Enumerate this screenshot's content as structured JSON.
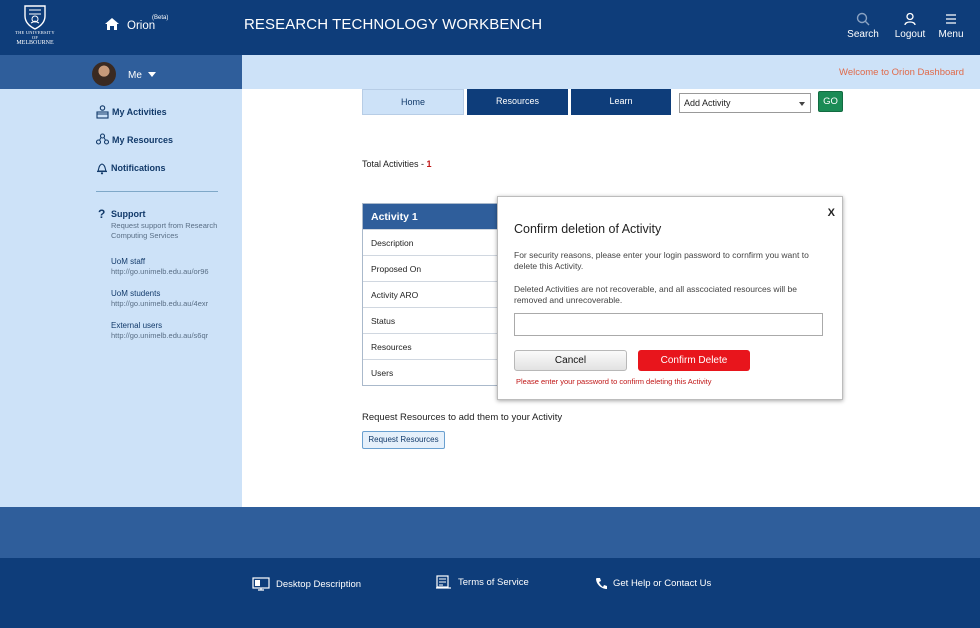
{
  "header": {
    "logo_line1": "THE UNIVERSITY OF",
    "logo_line2": "MELBOURNE",
    "app_name": "Orion",
    "app_badge": "(Beta)",
    "title": "RESEARCH TECHNOLOGY WORKBENCH",
    "tools": [
      {
        "label": "Search",
        "icon": "search-icon"
      },
      {
        "label": "Logout",
        "icon": "user-icon"
      },
      {
        "label": "Menu",
        "icon": "menu-icon"
      }
    ]
  },
  "user": {
    "name": "Me"
  },
  "welcome": "Welcome to Orion Dashboard",
  "sidebar": {
    "items": [
      {
        "label": "My  Activities",
        "icon": "activities-icon"
      },
      {
        "label": "My Resources",
        "icon": "resources-icon"
      },
      {
        "label": "Notifications",
        "icon": "bell-icon"
      }
    ],
    "support": {
      "title": "Support",
      "desc": "Request support from Research Computing Services",
      "links": [
        {
          "title": "UoM staff",
          "url": "http://go.unimelb.edu.au/or96"
        },
        {
          "title": "UoM students",
          "url": "http://go.unimelb.edu.au/4exr"
        },
        {
          "title": "External users",
          "url": "http://go.unimelb.edu.au/s6qr"
        }
      ]
    }
  },
  "tabs": [
    {
      "label": "Home",
      "active": true
    },
    {
      "label": "Resources",
      "active": false
    },
    {
      "label": "Learn",
      "active": false
    }
  ],
  "add_select": {
    "value": "Add Activity"
  },
  "go_label": "GO",
  "total": {
    "label": "Total Activities  - ",
    "count": "1"
  },
  "activity_card": {
    "title": "Activity 1",
    "rows": [
      "Description",
      "Proposed On",
      "Activity ARO",
      "Status",
      "Resources",
      "Users"
    ]
  },
  "request": {
    "text": "Request Resources to add them to your  Activity",
    "button": "Request Resources"
  },
  "modal": {
    "close": "X",
    "title": "Confirm deletion of Activity",
    "p1": "For security reasons, please enter your login password to cornfirm you want to delete this Activity.",
    "p2": "Deleted Activities are not recoverable, and all asscociated resources will be removed and unrecoverable.",
    "password_value": "",
    "cancel": "Cancel",
    "confirm": "Confirm Delete",
    "error": "Please enter your password to confirm deleting this Activity"
  },
  "footer": {
    "links": [
      {
        "label": "Desktop Description",
        "icon": "monitor-icon"
      },
      {
        "label": "Terms of Service",
        "icon": "terms-icon"
      },
      {
        "label": "Get Help or Contact Us",
        "icon": "phone-icon"
      }
    ]
  },
  "colors": {
    "navy": "#0e3d7a",
    "mid_blue": "#2f5e9b",
    "light_blue": "#cde2f8",
    "go_green": "#1a8b55",
    "danger_red": "#e8151c",
    "welcome_orange": "#e06a4a"
  }
}
